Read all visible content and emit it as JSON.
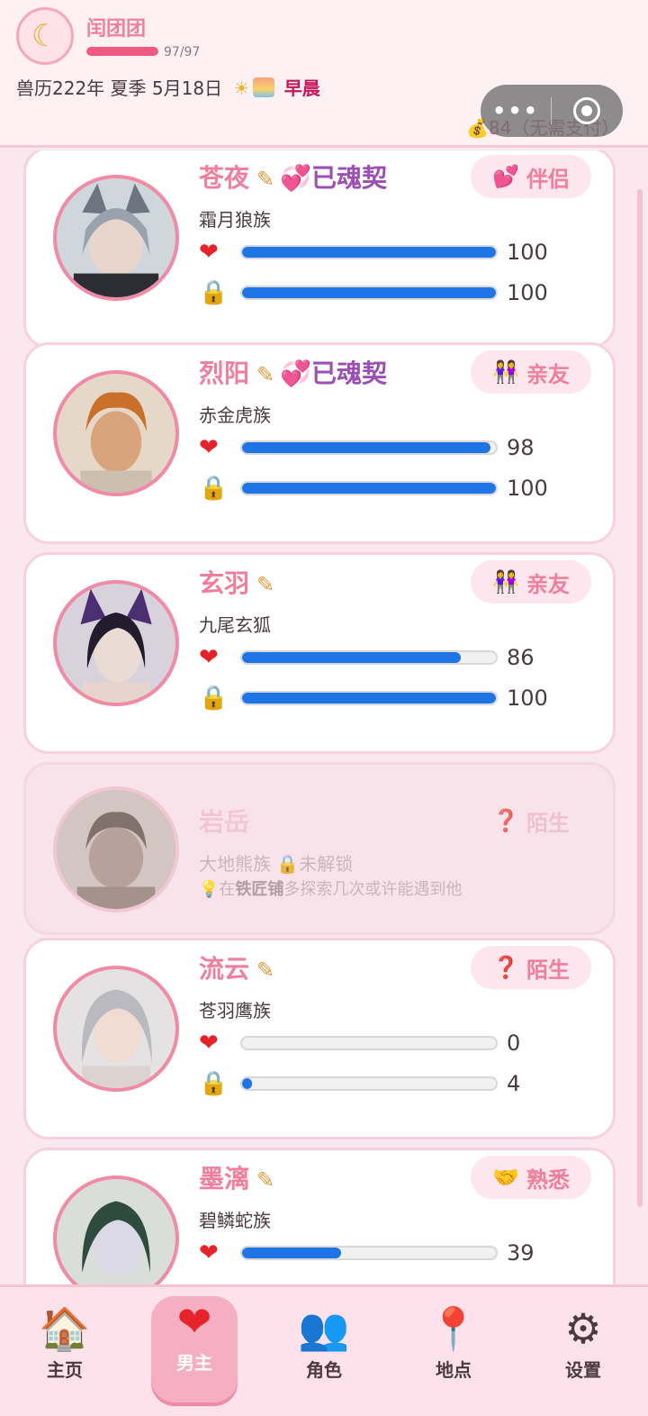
{
  "header": {
    "player_name": "闰团团",
    "hp_text": "97/97",
    "hp_fraction": 1.0,
    "date_text": "兽历222年 夏季 5月18日",
    "time_of_day": "早晨",
    "money": "💰84（无需支付）",
    "avatar_icon": "moon-icon"
  },
  "characters": [
    {
      "name": "苍夜",
      "soul_bound": "已魂契",
      "race": "霜月狼族",
      "relation_icon": "💕",
      "relation": "伴侣",
      "affection": 100,
      "lock": 100
    },
    {
      "name": "烈阳",
      "soul_bound": "已魂契",
      "race": "赤金虎族",
      "relation_icon": "👭",
      "relation": "亲友",
      "affection": 98,
      "lock": 100
    },
    {
      "name": "玄羽",
      "soul_bound": "",
      "race": "九尾玄狐",
      "relation_icon": "👭",
      "relation": "亲友",
      "affection": 86,
      "lock": 100
    },
    {
      "name": "岩岳",
      "race": "大地熊族",
      "locked_text": "🔒未解锁",
      "hint_prefix": "💡在",
      "hint_place": "铁匠铺",
      "hint_suffix": "多探索几次或许能遇到他",
      "relation_icon": "❓",
      "relation": "陌生"
    },
    {
      "name": "流云",
      "soul_bound": "",
      "race": "苍羽鹰族",
      "relation_icon": "❓",
      "relation": "陌生",
      "affection": 0,
      "lock": 4
    },
    {
      "name": "墨漓",
      "soul_bound": "",
      "race": "碧鳞蛇族",
      "relation_icon": "🤝",
      "relation": "熟悉",
      "affection": 39
    }
  ],
  "nav": [
    {
      "label": "主页",
      "icon": "home-icon",
      "active": false
    },
    {
      "label": "男主",
      "icon": "heart-icon",
      "active": true
    },
    {
      "label": "角色",
      "icon": "people-icon",
      "active": false
    },
    {
      "label": "地点",
      "icon": "pin-icon",
      "active": false
    },
    {
      "label": "设置",
      "icon": "gear-icon",
      "active": false
    }
  ],
  "colors": {
    "accent": "#ef7f9c",
    "bar": "#1f74e6",
    "soul": "#9b4fb5",
    "morning": "#c2185b"
  }
}
